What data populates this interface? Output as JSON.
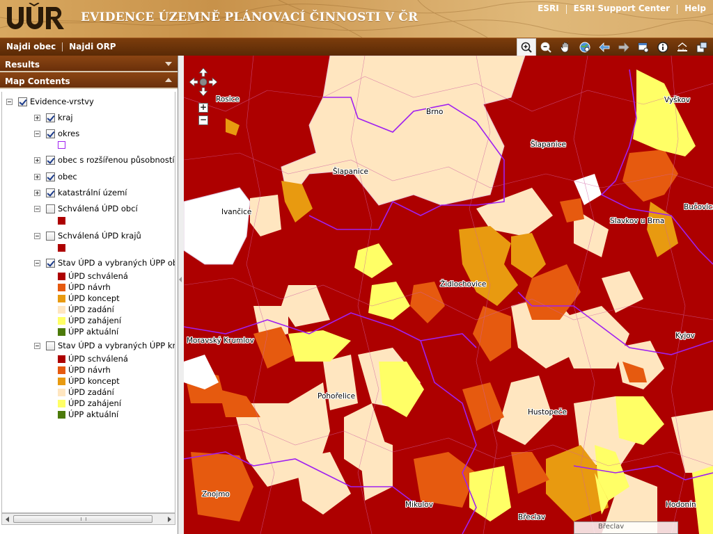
{
  "header": {
    "logo_text": "ÚÚR",
    "title": "EVIDENCE ÚZEMNĚ PLÁNOVACÍ ČINNOSTI V ČR",
    "links": [
      "ESRI",
      "ESRI Support Center",
      "Help"
    ]
  },
  "nav": {
    "links": [
      "Najdi obec",
      "Najdi ORP"
    ]
  },
  "toolbar": {
    "tools": [
      "zoom-in-icon",
      "zoom-out-icon",
      "pan-hand-icon",
      "full-extent-icon",
      "previous-extent-icon",
      "next-extent-icon",
      "select-icon",
      "identify-icon",
      "measure-icon",
      "overview-icon"
    ]
  },
  "panels": {
    "results": "Results",
    "map_contents": "Map Contents"
  },
  "toc": {
    "root": "Evidence-vrstvy",
    "layers": [
      {
        "label": "kraj",
        "checked": true
      },
      {
        "label": "okres",
        "checked": true
      },
      {
        "label": "obec s rozšířenou působností",
        "checked": true
      },
      {
        "label": "obec",
        "checked": true
      },
      {
        "label": "katastrální území",
        "checked": true
      },
      {
        "label": "Schválená ÚPD obcí",
        "checked": false
      },
      {
        "label": "Schválená ÚPD krajů",
        "checked": false
      },
      {
        "label": "Stav ÚPD a vybraných ÚPP obcí",
        "checked": true
      },
      {
        "label": "Stav ÚPD a vybraných ÚPP krajů",
        "checked": false
      }
    ],
    "legend_a": [
      "ÚPD schválená",
      "ÚPD návrh",
      "ÚPD koncept",
      "ÚPD zadání",
      "ÚPD zahájení",
      "ÚPP aktuální"
    ],
    "legend_b": [
      "ÚPD schválená",
      "ÚPD návrh",
      "ÚPD koncept",
      "ÚPD zadání",
      "ÚPD zahájení",
      "ÚPP aktuální"
    ]
  },
  "colors": {
    "schvalena": "#ad0000",
    "navrh": "#e65a0f",
    "koncept": "#e89a10",
    "zadani": "#ffe6c0",
    "zahajeni": "#ffff66",
    "aktualni": "#4c7a0a",
    "okres_outline": "#a020f0",
    "header_brown": "#6a300a"
  },
  "map": {
    "places": [
      "Rosice",
      "Brno",
      "Vyškov",
      "Šlapanice",
      "Šlapanice",
      "Ivančice",
      "Bučovice",
      "Slavkov u Brna",
      "Židlochovice",
      "Moravský Krumlov",
      "Kyjov",
      "Pohořelice",
      "Hustopeče",
      "Znojmo",
      "Mikulov",
      "Břeclav",
      "Hodonín"
    ],
    "scale_label": "Břeclav"
  }
}
